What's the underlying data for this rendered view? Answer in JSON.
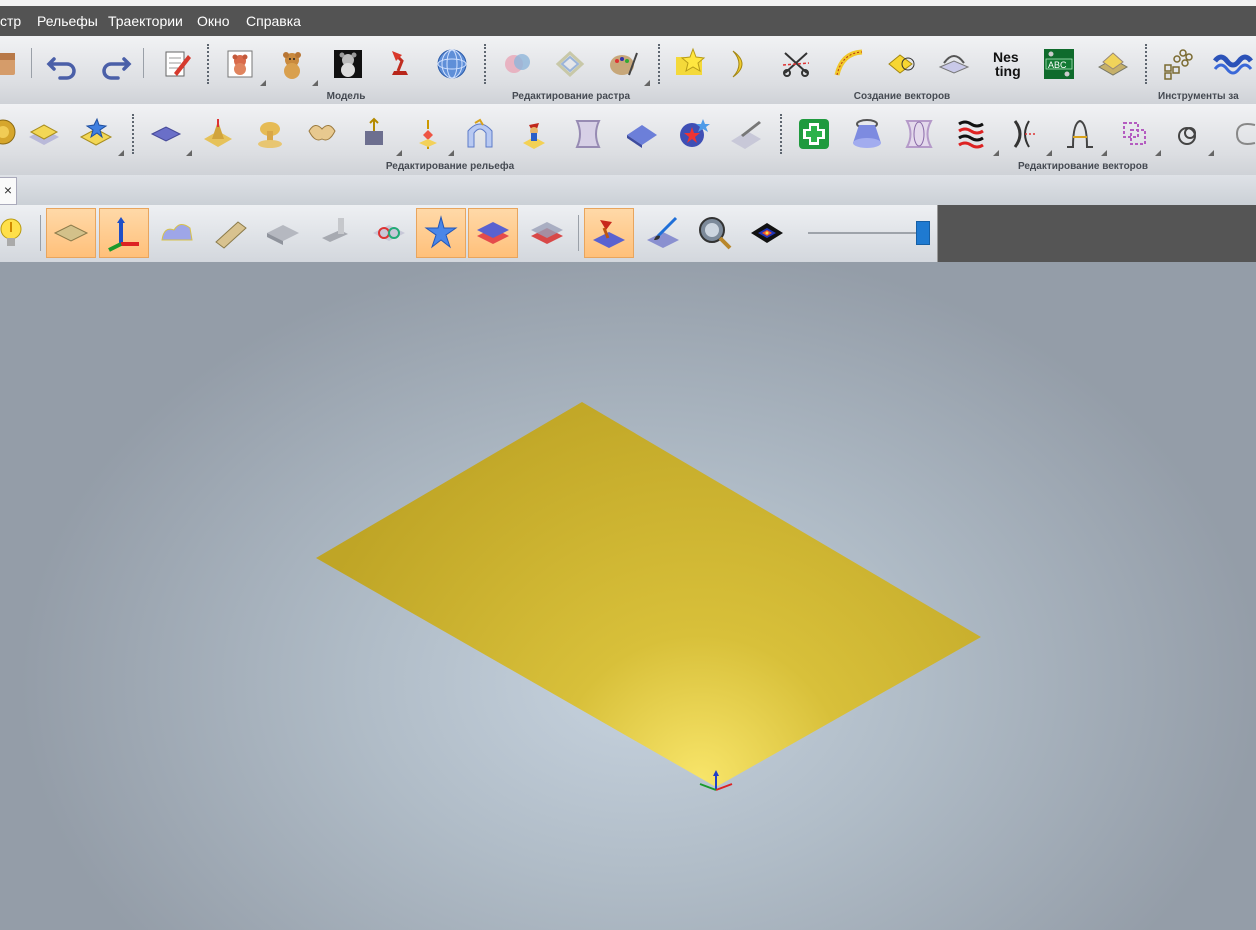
{
  "menu": {
    "items": [
      "стр",
      "Рельефы",
      "Траектории",
      "Окно",
      "Справка"
    ]
  },
  "toolbar": {
    "group_labels": {
      "model": "Модель",
      "raster_editing": "Редактирование растра",
      "vector_creation": "Создание векторов",
      "tools": "Инструменты за",
      "relief_editing": "Редактирование рельефа",
      "vector_editing": "Редактирование векторов"
    },
    "nesting_icon_text": "Nes\nting",
    "abc_icon_text": "ABC"
  },
  "document_tab": {
    "close_glyph": "×"
  },
  "view_toolbar": {
    "active_tools": [
      "plane-view",
      "axes-view",
      "star-relief",
      "layer-stack",
      "lamp-relief"
    ],
    "slider_level_percent": 95
  },
  "colors": {
    "menubar": "#535353",
    "relief_plate": "#c4ad2b",
    "relief_highlight": "#f8e56a",
    "active_tool": "#ffc98c",
    "slider_thumb": "#1f7ad1",
    "viewport_center": "#c6d2de",
    "viewport_edge": "#949da8"
  }
}
